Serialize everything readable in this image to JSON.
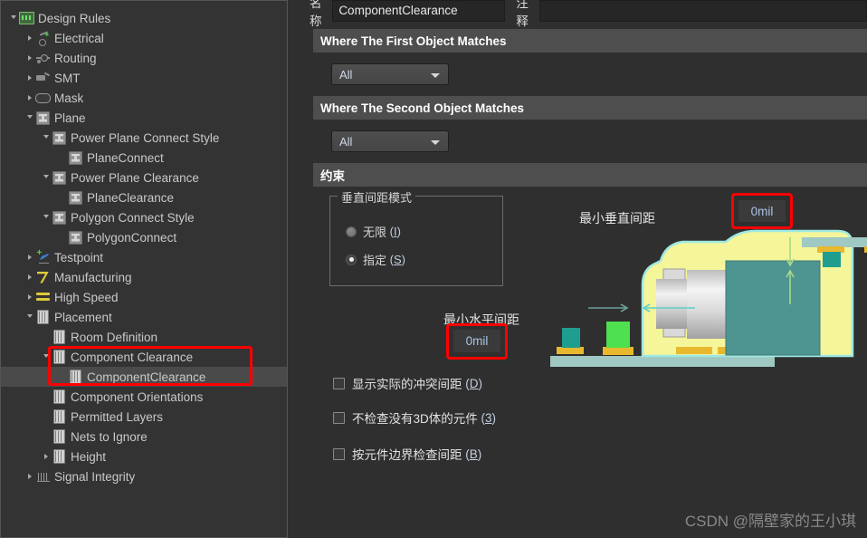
{
  "window": {
    "background_color": "#2f2f2f"
  },
  "sidebar": {
    "name": "Design Rules Tree",
    "items": [
      {
        "label": "Design Rules",
        "depth": 0,
        "icon": "folder-rules-icon",
        "arrow": "open",
        "selected": false
      },
      {
        "label": "Electrical",
        "depth": 1,
        "icon": "electrical-icon",
        "arrow": "closed",
        "selected": false
      },
      {
        "label": "Routing",
        "depth": 1,
        "icon": "routing-icon",
        "arrow": "closed",
        "selected": false
      },
      {
        "label": "SMT",
        "depth": 1,
        "icon": "smt-icon",
        "arrow": "closed",
        "selected": false
      },
      {
        "label": "Mask",
        "depth": 1,
        "icon": "mask-icon",
        "arrow": "closed",
        "selected": false
      },
      {
        "label": "Plane",
        "depth": 1,
        "icon": "plane-icon",
        "arrow": "open",
        "selected": false
      },
      {
        "label": "Power Plane Connect Style",
        "depth": 2,
        "icon": "plane-icon",
        "arrow": "open",
        "selected": false
      },
      {
        "label": "PlaneConnect",
        "depth": 3,
        "icon": "plane-icon",
        "arrow": "none",
        "selected": false
      },
      {
        "label": "Power Plane Clearance",
        "depth": 2,
        "icon": "plane-icon",
        "arrow": "open",
        "selected": false
      },
      {
        "label": "PlaneClearance",
        "depth": 3,
        "icon": "plane-icon",
        "arrow": "none",
        "selected": false
      },
      {
        "label": "Polygon Connect Style",
        "depth": 2,
        "icon": "plane-icon",
        "arrow": "open",
        "selected": false
      },
      {
        "label": "PolygonConnect",
        "depth": 3,
        "icon": "plane-icon",
        "arrow": "none",
        "selected": false
      },
      {
        "label": "Testpoint",
        "depth": 1,
        "icon": "testpoint-icon",
        "arrow": "closed",
        "selected": false
      },
      {
        "label": "Manufacturing",
        "depth": 1,
        "icon": "manufacturing-icon",
        "arrow": "closed",
        "selected": false
      },
      {
        "label": "High Speed",
        "depth": 1,
        "icon": "high-speed-icon",
        "arrow": "closed",
        "selected": false
      },
      {
        "label": "Placement",
        "depth": 1,
        "icon": "placement-icon",
        "arrow": "open",
        "selected": false
      },
      {
        "label": "Room Definition",
        "depth": 2,
        "icon": "placement-icon",
        "arrow": "none",
        "selected": false
      },
      {
        "label": "Component Clearance",
        "depth": 2,
        "icon": "placement-icon",
        "arrow": "open",
        "selected": false
      },
      {
        "label": "ComponentClearance",
        "depth": 3,
        "icon": "placement-icon",
        "arrow": "none",
        "selected": true
      },
      {
        "label": "Component Orientations",
        "depth": 2,
        "icon": "placement-icon",
        "arrow": "none",
        "selected": false
      },
      {
        "label": "Permitted Layers",
        "depth": 2,
        "icon": "placement-icon",
        "arrow": "none",
        "selected": false
      },
      {
        "label": "Nets to Ignore",
        "depth": 2,
        "icon": "placement-icon",
        "arrow": "none",
        "selected": false
      },
      {
        "label": "Height",
        "depth": 2,
        "icon": "placement-icon",
        "arrow": "closed",
        "selected": false
      },
      {
        "label": "Signal Integrity",
        "depth": 1,
        "icon": "signal-integrity-icon",
        "arrow": "closed",
        "selected": false
      }
    ],
    "highlight_color": "#fe0000"
  },
  "rule_form": {
    "name_label": "名称",
    "name_value": "ComponentClearance",
    "comment_label": "注释",
    "comment_value": ""
  },
  "sections": {
    "first_object": {
      "header": "Where The First Object Matches",
      "scope_value": "All"
    },
    "second_object": {
      "header": "Where The Second Object Matches",
      "scope_value": "All"
    },
    "constraints": {
      "header": "约束"
    }
  },
  "vertical_mode": {
    "group_title": "垂直间距模式",
    "options": [
      {
        "label": "无限",
        "accel": "I",
        "selected": false
      },
      {
        "label": "指定",
        "accel": "S",
        "selected": true
      }
    ]
  },
  "checkboxes": [
    {
      "label": "显示实际的冲突间距",
      "accel": "D",
      "checked": false
    },
    {
      "label": "不检查没有3D体的元件",
      "accel": "3",
      "checked": false
    },
    {
      "label": "按元件边界检查间距",
      "accel": "B",
      "checked": false
    }
  ],
  "diagram": {
    "vertical_label": "最小垂直间距",
    "vertical_value": "0mil",
    "horizontal_label": "最小水平间距",
    "horizontal_value": "0mil",
    "value_text_color": "#a9c4e8",
    "highlight_color": "#fe0000"
  },
  "watermark": {
    "text": "CSDN @隔壁家的王小琪"
  }
}
